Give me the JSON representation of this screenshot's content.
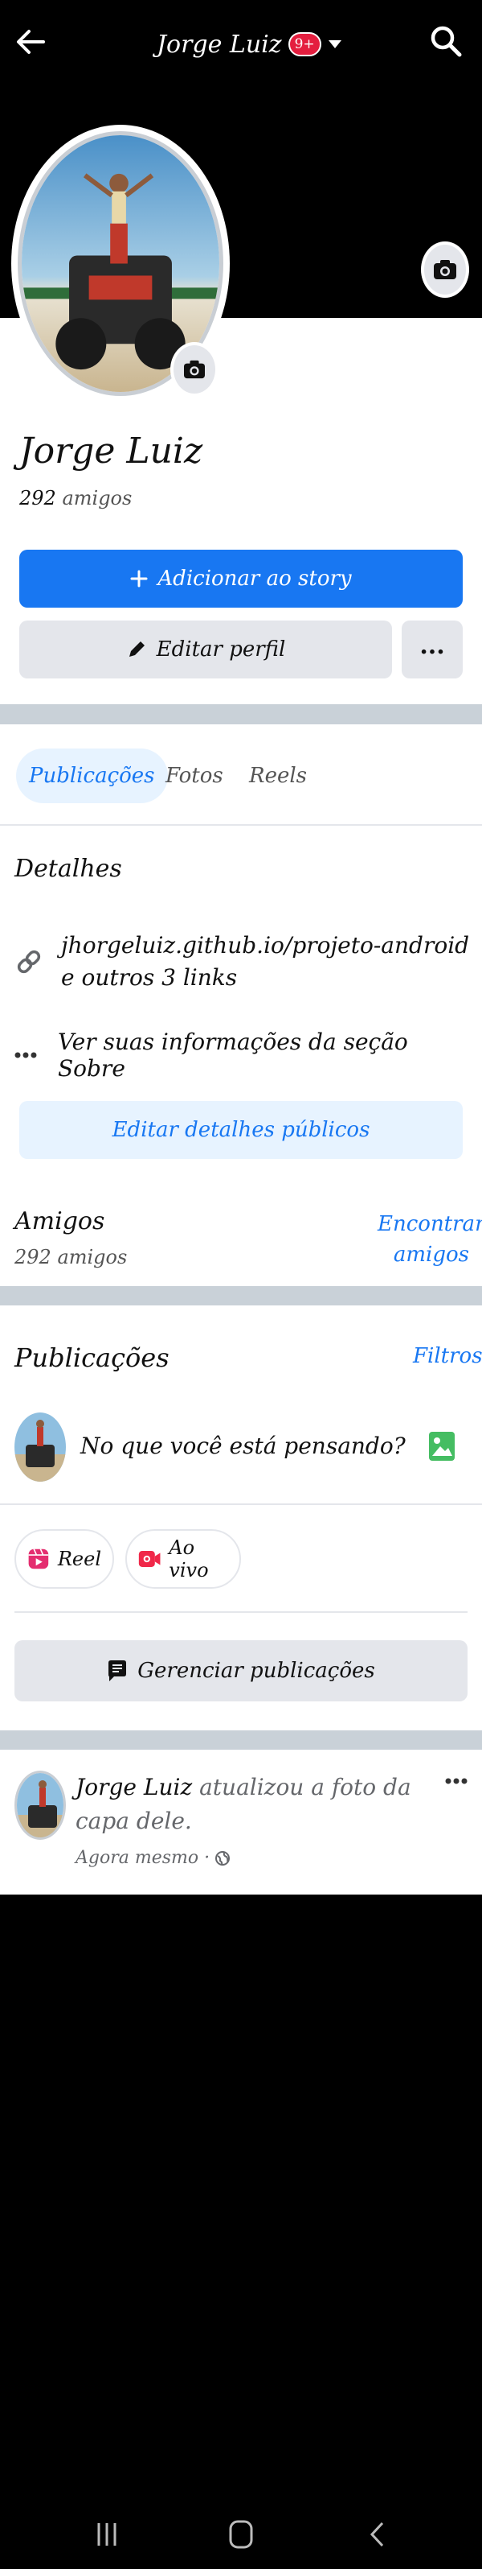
{
  "header": {
    "title": "Jorge Luiz",
    "badge": "9+"
  },
  "profile": {
    "name": "Jorge Luiz",
    "friends_count": "292",
    "friends_label": "amigos",
    "add_story_label": "Adicionar ao story",
    "edit_profile_label": "Editar perfil",
    "more_label": "..."
  },
  "tabs": [
    {
      "label": "Publicações"
    },
    {
      "label": "Fotos"
    },
    {
      "label": "Reels"
    }
  ],
  "details": {
    "title": "Detalhes",
    "link_text": "jhorgeluiz.github.io/projeto-android e outros 3 links",
    "about_text": "Ver suas informações da seção Sobre",
    "edit_button": "Editar detalhes públicos"
  },
  "friends": {
    "title": "Amigos",
    "subtitle": "292 amigos",
    "find_label": "Encontrar amigos"
  },
  "publications": {
    "title": "Publicações",
    "filters_label": "Filtros",
    "composer_placeholder": "No que você está pensando?",
    "reel_label": "Reel",
    "live_label": "Ao vivo",
    "manage_label": "Gerenciar publicações"
  },
  "post": {
    "author": "Jorge Luiz",
    "action": " atualizou a foto da capa dele.",
    "time": "Agora mesmo ·"
  },
  "colors": {
    "accent": "#1877f2",
    "badge": "#e41e3f",
    "photo_icon": "#45bd62",
    "reel_icon": "#e42d6f",
    "live_icon": "#f02849"
  },
  "icons": [
    "back-arrow-icon",
    "chevron-down-icon",
    "search-icon",
    "camera-icon",
    "plus-icon",
    "pencil-icon",
    "link-icon",
    "ellipsis-icon",
    "photo-icon",
    "reel-icon",
    "live-icon",
    "manage-icon",
    "globe-icon"
  ]
}
